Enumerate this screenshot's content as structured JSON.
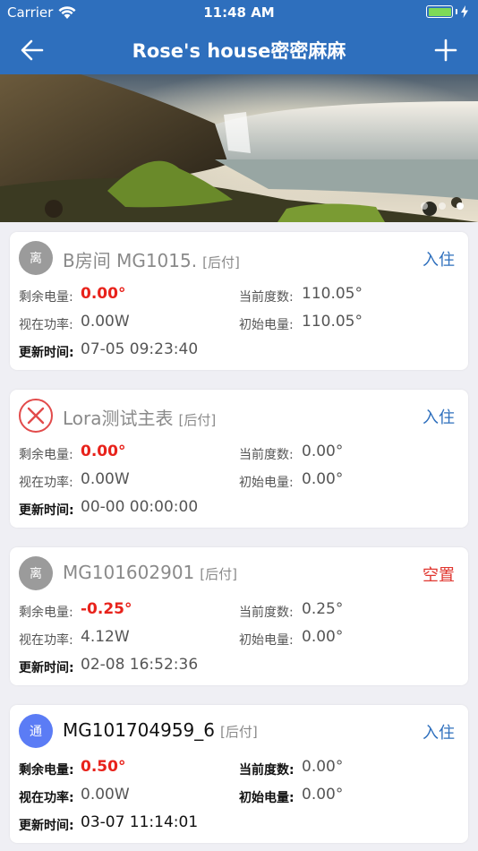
{
  "status_bar": {
    "carrier": "Carrier",
    "time": "11:48 AM"
  },
  "nav": {
    "title": "Rose's house密密麻麻"
  },
  "banner": {
    "active_slide": 3,
    "slide_count": 3
  },
  "labels": {
    "remaining": "剩余电量:",
    "current_reading": "当前度数:",
    "power": "视在功率:",
    "initial": "初始电量:",
    "updated": "更新时间:"
  },
  "cards": [
    {
      "status_icon": "离",
      "status_type": "offline",
      "name": "B房间 MG1015.",
      "tag": "[后付]",
      "action": "入住",
      "remaining": "0.00°",
      "current_reading": "110.05°",
      "power": "0.00W",
      "initial": "110.05°",
      "updated": "07-05 09:23:40"
    },
    {
      "status_icon": "",
      "status_type": "error",
      "name": "Lora测试主表",
      "tag": "[后付]",
      "action": "入住",
      "remaining": "0.00°",
      "current_reading": "0.00°",
      "power": "0.00W",
      "initial": "0.00°",
      "updated": "00-00 00:00:00"
    },
    {
      "status_icon": "离",
      "status_type": "offline",
      "name": "MG101602901",
      "tag": "[后付]",
      "action": "空置",
      "remaining": "-0.25°",
      "current_reading": "0.25°",
      "power": "4.12W",
      "initial": "0.00°",
      "updated": "02-08 16:52:36"
    },
    {
      "status_icon": "通",
      "status_type": "online",
      "name": "MG101704959_6",
      "tag": "[后付]",
      "action": "入住",
      "remaining": "0.50°",
      "current_reading": "0.00°",
      "power": "0.00W",
      "initial": "0.00°",
      "updated": "03-07 11:14:01"
    }
  ],
  "colors": {
    "nav_blue": "#2e6fbd",
    "value_red": "#e8221b",
    "online_blue": "#5b7cf5",
    "offline_gray": "#9b9b9b",
    "error_red": "#e24b4b"
  }
}
